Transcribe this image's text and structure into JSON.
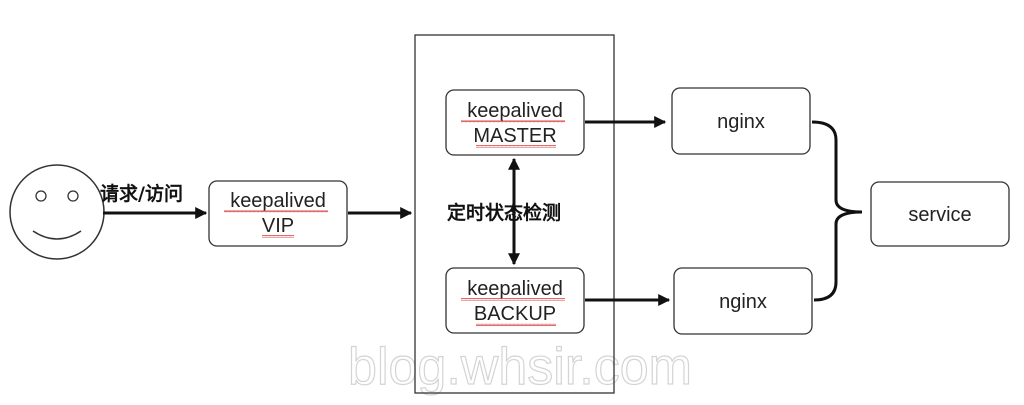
{
  "request_label": "请求/访问",
  "vip": {
    "line1": "keepalived",
    "line2": "VIP"
  },
  "master": {
    "line1": "keepalived",
    "line2": "MASTER"
  },
  "backup": {
    "line1": "keepalived",
    "line2": "BACKUP"
  },
  "health_check_label": "定时状态检测",
  "nginx_top": "nginx",
  "nginx_bottom": "nginx",
  "service": "service",
  "watermark": "blog.whsir.com",
  "colors": {
    "stroke": "#222222",
    "underline": "#d94545",
    "watermark": "#d4d4d4"
  }
}
